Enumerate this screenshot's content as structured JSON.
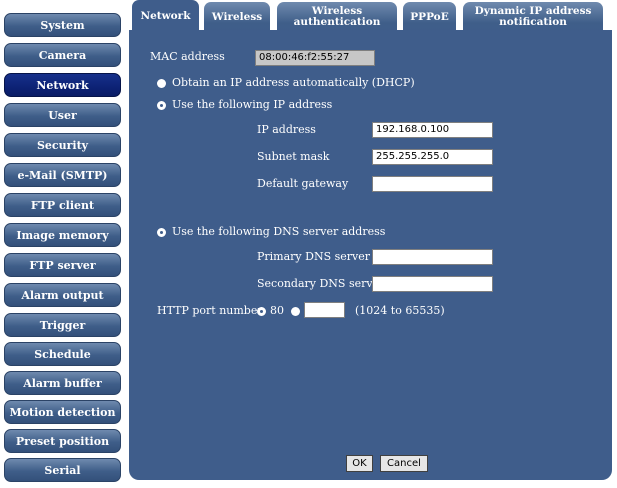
{
  "sidebar": {
    "items": [
      {
        "label": "System"
      },
      {
        "label": "Camera"
      },
      {
        "label": "Network"
      },
      {
        "label": "User"
      },
      {
        "label": "Security"
      },
      {
        "label": "e-Mail (SMTP)"
      },
      {
        "label": "FTP client"
      },
      {
        "label": "Image memory"
      },
      {
        "label": "FTP server"
      },
      {
        "label": "Alarm output"
      },
      {
        "label": "Trigger"
      },
      {
        "label": "Schedule"
      },
      {
        "label": "Alarm buffer"
      },
      {
        "label": "Motion detection"
      },
      {
        "label": "Preset position"
      },
      {
        "label": "Serial"
      }
    ],
    "active": "Network"
  },
  "tabs": [
    {
      "label": "Network"
    },
    {
      "label": "Wireless"
    },
    {
      "label": "Wireless authentication"
    },
    {
      "label": "PPPoE"
    },
    {
      "label": "Dynamic IP address notification"
    }
  ],
  "form": {
    "mac_label": "MAC address",
    "mac_value": "08:00:46:f2:55:27",
    "dhcp_label": "Obtain an IP address automatically (DHCP)",
    "static_label": "Use the following IP address",
    "ip_label": "IP address",
    "ip_value": "192.168.0.100",
    "subnet_label": "Subnet mask",
    "subnet_value": "255.255.255.0",
    "gateway_label": "Default gateway",
    "gateway_value": "",
    "dns_label": "Use the following DNS server address",
    "primary_dns_label": "Primary DNS server",
    "primary_dns_value": "",
    "secondary_dns_label": "Secondary DNS server",
    "secondary_dns_value": "",
    "http_port_label": "HTTP port number",
    "http_port_default": "80",
    "http_port_custom_value": "",
    "http_port_range": "(1024 to 65535)"
  },
  "buttons": {
    "ok": "OK",
    "cancel": "Cancel"
  }
}
